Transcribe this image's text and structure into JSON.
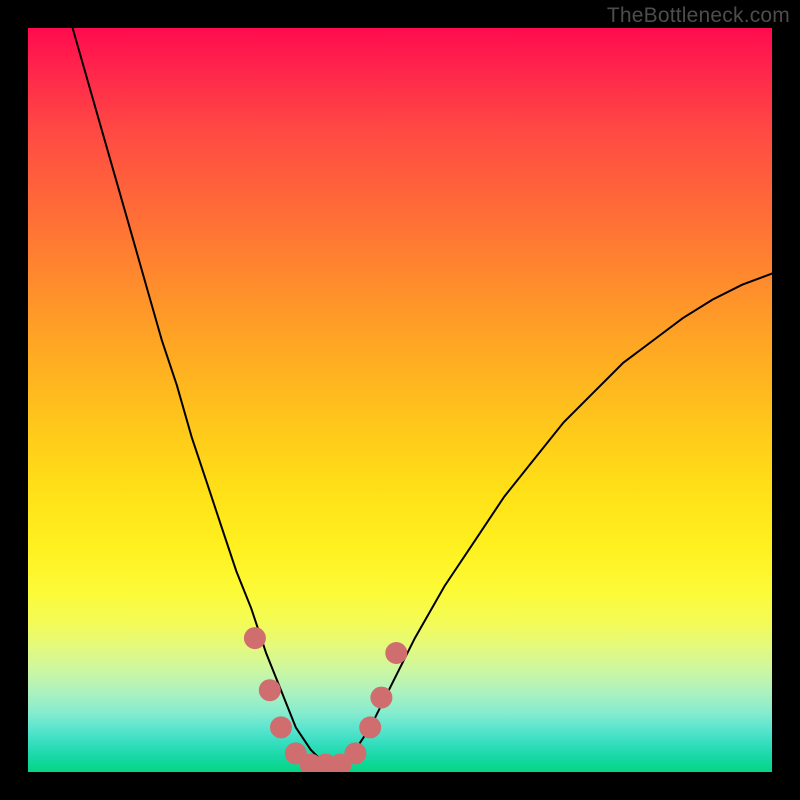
{
  "watermark": "TheBottleneck.com",
  "colors": {
    "frame": "#000000",
    "curve": "#000000",
    "marker": "#cf6d6f",
    "gradient_top": "#ff0b4e",
    "gradient_bottom": "#04d681"
  },
  "chart_data": {
    "type": "line",
    "title": "",
    "xlabel": "",
    "ylabel": "",
    "xlim": [
      0,
      100
    ],
    "ylim": [
      0,
      100
    ],
    "grid": false,
    "legend": false,
    "note": "Axes are unlabeled; values are normalized 0–100 estimated from pixel positions. y=0 at bottom (green), y=100 at top (red). The curve depicts bottleneck mismatch vs. an implied hardware-balance axis, dipping to ~0 near x≈35–43.",
    "series": [
      {
        "name": "bottleneck-curve",
        "x": [
          6,
          8,
          10,
          12,
          14,
          16,
          18,
          20,
          22,
          24,
          26,
          28,
          30,
          32,
          34,
          36,
          38,
          40,
          42,
          44,
          46,
          48,
          50,
          52,
          56,
          60,
          64,
          68,
          72,
          76,
          80,
          84,
          88,
          92,
          96,
          100
        ],
        "y": [
          100,
          93,
          86,
          79,
          72,
          65,
          58,
          52,
          45,
          39,
          33,
          27,
          22,
          16,
          11,
          6,
          3,
          1,
          1,
          3,
          6,
          10,
          14,
          18,
          25,
          31,
          37,
          42,
          47,
          51,
          55,
          58,
          61,
          63.5,
          65.5,
          67
        ]
      }
    ],
    "markers": {
      "name": "valley-highlight",
      "color": "#cf6d6f",
      "points": [
        {
          "x": 30.5,
          "y": 18
        },
        {
          "x": 32.5,
          "y": 11
        },
        {
          "x": 34,
          "y": 6
        },
        {
          "x": 36,
          "y": 2.5
        },
        {
          "x": 38,
          "y": 1
        },
        {
          "x": 40,
          "y": 1
        },
        {
          "x": 42,
          "y": 1
        },
        {
          "x": 44,
          "y": 2.5
        },
        {
          "x": 46,
          "y": 6
        },
        {
          "x": 47.5,
          "y": 10
        },
        {
          "x": 49.5,
          "y": 16
        }
      ]
    }
  }
}
